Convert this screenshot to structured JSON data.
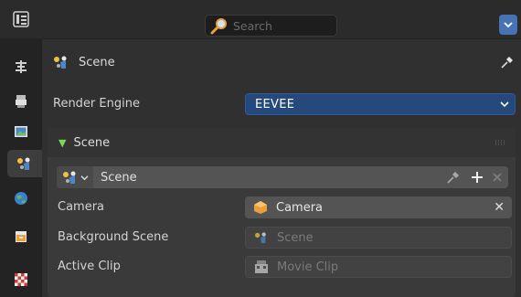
{
  "header": {
    "editor_type_icon": "properties-editor-icon",
    "search_placeholder": "Search",
    "options_icon": "chevron-down-icon",
    "accent_color": "#4772b3"
  },
  "tabs": [
    {
      "name": "tool",
      "icon": "tool-icon"
    },
    {
      "name": "render",
      "icon": "render-icon"
    },
    {
      "name": "output",
      "icon": "output-icon"
    },
    {
      "name": "view-layer",
      "icon": "image-icon"
    },
    {
      "name": "scene",
      "icon": "scene-icon",
      "active": true
    },
    {
      "name": "world",
      "icon": "world-icon"
    },
    {
      "name": "collection",
      "icon": "collection-icon"
    },
    {
      "name": "texture",
      "icon": "checker-icon"
    }
  ],
  "context": {
    "title": "Scene",
    "pin_icon": "pin-icon"
  },
  "render_engine": {
    "label": "Render Engine",
    "value": "EEVEE"
  },
  "scene_panel": {
    "title": "Scene",
    "id_block": {
      "name": "Scene"
    },
    "camera": {
      "label": "Camera",
      "value": "Camera"
    },
    "background_scene": {
      "label": "Background Scene",
      "placeholder": "Scene"
    },
    "active_clip": {
      "label": "Active Clip",
      "placeholder": "Movie Clip"
    }
  }
}
